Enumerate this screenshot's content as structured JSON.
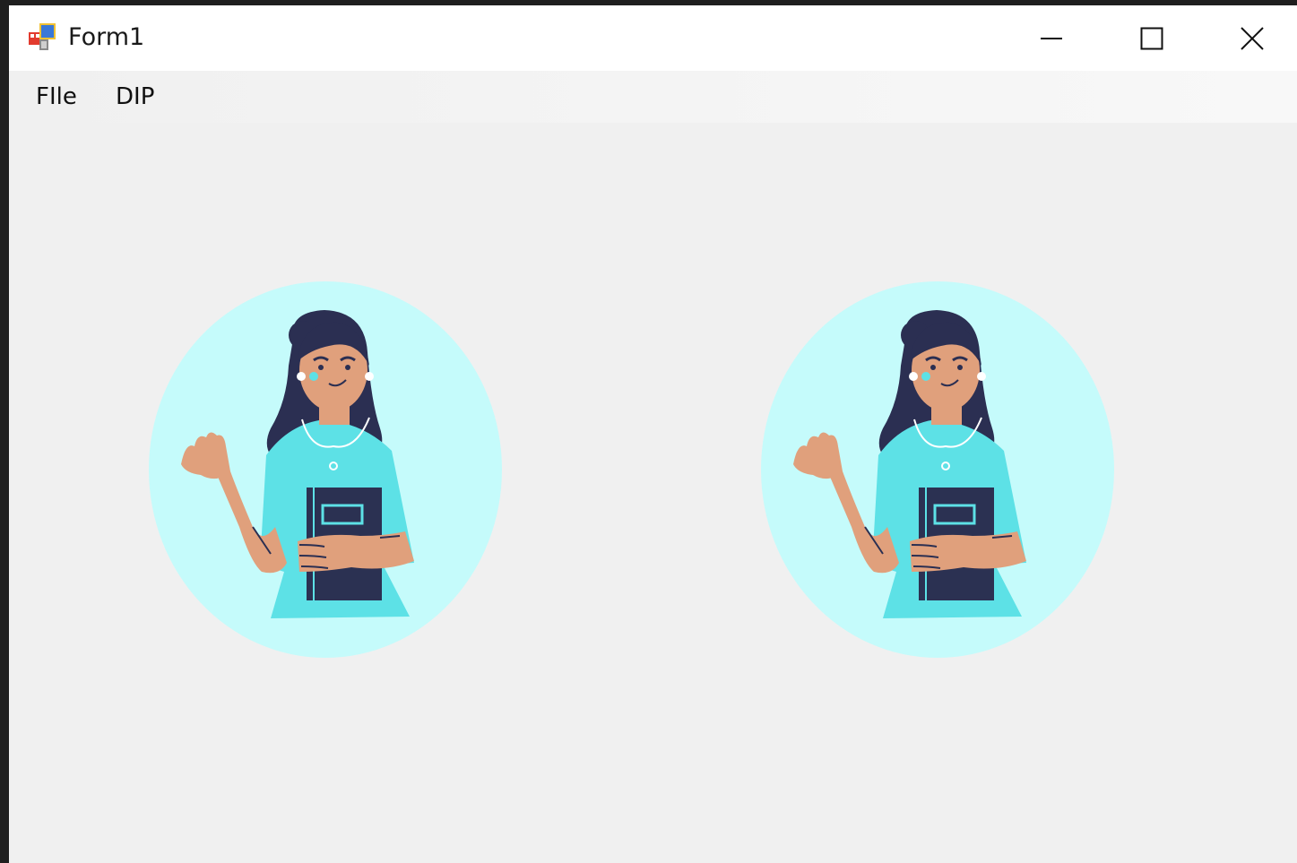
{
  "window": {
    "title": "Form1",
    "app_icon": "winforms-app-icon",
    "controls": {
      "minimize": "minimize-icon",
      "maximize": "maximize-icon",
      "close": "close-icon"
    }
  },
  "menu": {
    "items": [
      {
        "label": "FIle"
      },
      {
        "label": "DIP"
      }
    ]
  },
  "pictures": {
    "left": {
      "content": "woman-waving-with-notebook-illustration"
    },
    "right": {
      "content": "woman-waving-with-notebook-illustration"
    }
  },
  "colors": {
    "background": "#f0f0f0",
    "circle": "#c5fbfb",
    "shirt": "#5de1e6",
    "hair": "#2b2f52",
    "skin": "#e0a07c",
    "book": "#2b3152"
  }
}
